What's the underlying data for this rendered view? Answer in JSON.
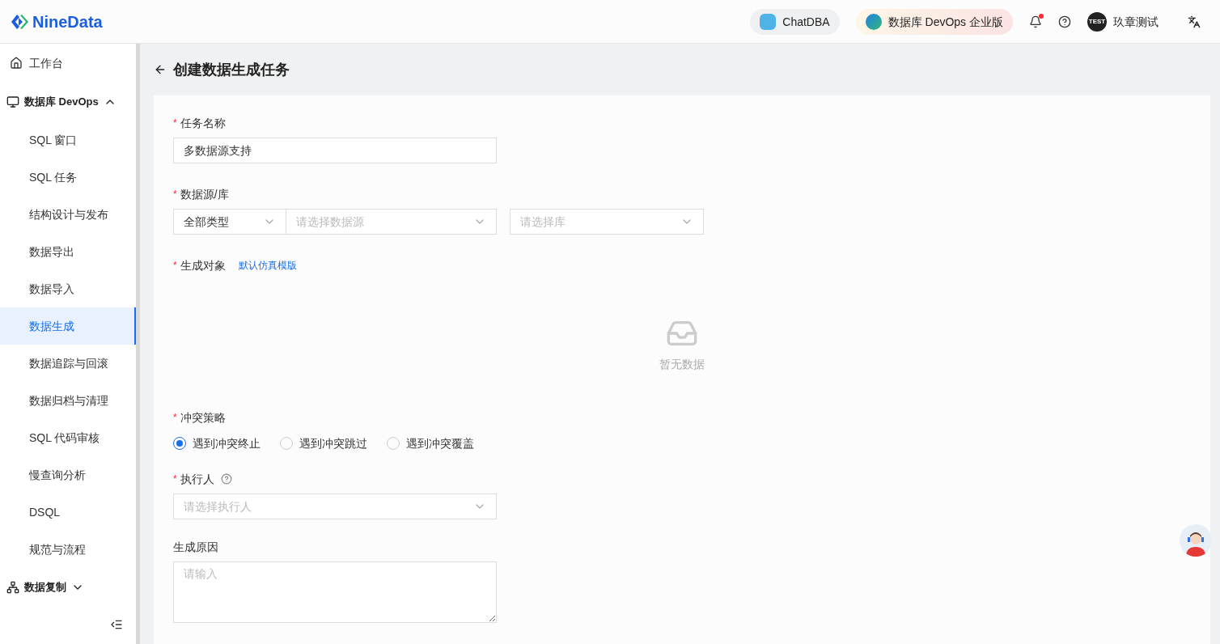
{
  "header": {
    "logo": "NineData",
    "chat_button": "ChatDBA",
    "edition_button": "数据库 DevOps 企业版",
    "notification_dot": true,
    "user": {
      "avatar": "TEST",
      "name": "玖章测试"
    }
  },
  "sidebar": {
    "items": [
      {
        "label": "工作台",
        "kind": "top"
      },
      {
        "label": "数据库 DevOps",
        "kind": "group",
        "expanded": true,
        "children": [
          {
            "label": "SQL 窗口",
            "selected": false
          },
          {
            "label": "SQL 任务",
            "selected": false
          },
          {
            "label": "结构设计与发布",
            "selected": false
          },
          {
            "label": "数据导出",
            "selected": false
          },
          {
            "label": "数据导入",
            "selected": false
          },
          {
            "label": "数据生成",
            "selected": true
          },
          {
            "label": "数据追踪与回滚",
            "selected": false
          },
          {
            "label": "数据归档与清理",
            "selected": false
          },
          {
            "label": "SQL 代码审核",
            "selected": false
          },
          {
            "label": "慢查询分析",
            "selected": false
          },
          {
            "label": "DSQL",
            "selected": false
          },
          {
            "label": "规范与流程",
            "selected": false
          }
        ]
      },
      {
        "label": "数据复制",
        "kind": "group",
        "expanded": false
      }
    ]
  },
  "page": {
    "title": "创建数据生成任务"
  },
  "form": {
    "task_name": {
      "label": "任务名称",
      "marker": "*",
      "value": "多数据源支持"
    },
    "source": {
      "label": "数据源/库",
      "marker": "*",
      "type_select": "全部类型",
      "source_placeholder": "请选择数据源",
      "db_placeholder": "请选择库"
    },
    "objects": {
      "label": "生成对象",
      "marker": "*",
      "link": "默认仿真模版",
      "empty_text": "暂无数据"
    },
    "conflict": {
      "label": "冲突策略",
      "marker": "*",
      "options": [
        {
          "label": "遇到冲突终止",
          "selected": true
        },
        {
          "label": "遇到冲突跳过",
          "selected": false
        },
        {
          "label": "遇到冲突覆盖",
          "selected": false
        }
      ]
    },
    "executor": {
      "label": "执行人",
      "marker": "*",
      "placeholder": "请选择执行人"
    },
    "reason": {
      "label": "生成原因",
      "placeholder": "请输入"
    }
  }
}
